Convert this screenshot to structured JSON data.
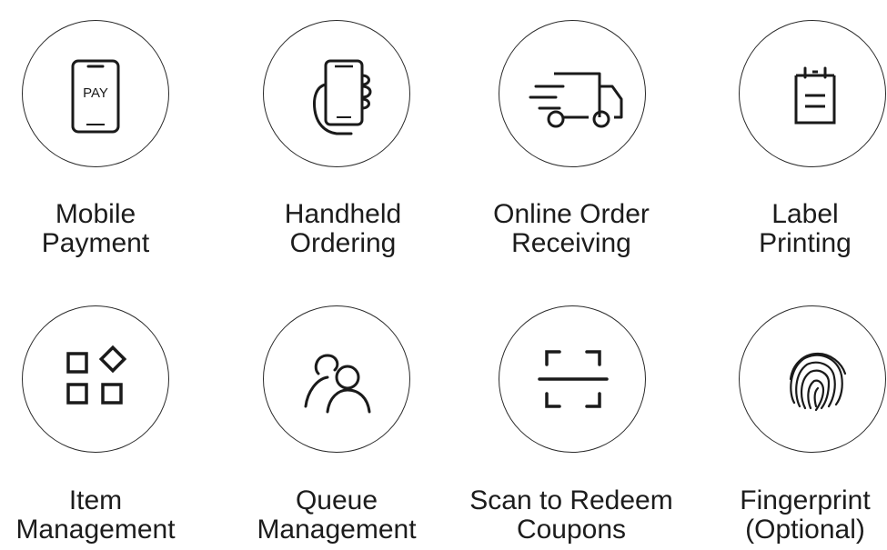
{
  "features": [
    {
      "icon": "mobile-pay-icon",
      "line1": "Mobile",
      "line2": "Payment",
      "pay_text": "PAY"
    },
    {
      "icon": "handheld-phone-icon",
      "line1": "Handheld",
      "line2": "Ordering"
    },
    {
      "icon": "delivery-truck-icon",
      "line1": "Online Order",
      "line2": "Receiving"
    },
    {
      "icon": "clipboard-label-icon",
      "line1": "Label",
      "line2": "Printing"
    },
    {
      "icon": "item-grid-icon",
      "line1": "Item",
      "line2": "Management"
    },
    {
      "icon": "people-queue-icon",
      "line1": "Queue",
      "line2": "Management"
    },
    {
      "icon": "scan-frame-icon",
      "line1": "Scan to Redeem",
      "line2": "Coupons"
    },
    {
      "icon": "fingerprint-icon",
      "line1": "Fingerprint",
      "line2": "(Optional)"
    }
  ]
}
